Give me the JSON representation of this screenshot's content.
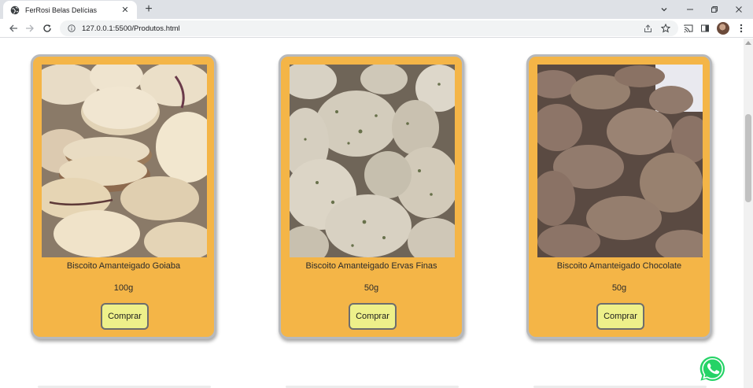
{
  "browser": {
    "tab_title": "FerRosi Belas Delícias",
    "url": "127.0.0.1:5500/Produtos.html"
  },
  "products": [
    {
      "name": "Biscoito Amanteigado Goiaba",
      "weight": "100g",
      "buy_label": "Comprar",
      "image": "butter-cookies-guava-photo"
    },
    {
      "name": "Biscoito Amanteigado Ervas Finas",
      "weight": "50g",
      "buy_label": "Comprar",
      "image": "herb-cookies-photo"
    },
    {
      "name": "Biscoito Amanteigado Chocolate",
      "weight": "50g",
      "buy_label": "Comprar",
      "image": "chocolate-cookies-photo"
    }
  ],
  "colors": {
    "card_background": "#f4b547",
    "card_border": "#b7b9bc",
    "button_background": "#eef08a",
    "whatsapp_green": "#25d366"
  }
}
